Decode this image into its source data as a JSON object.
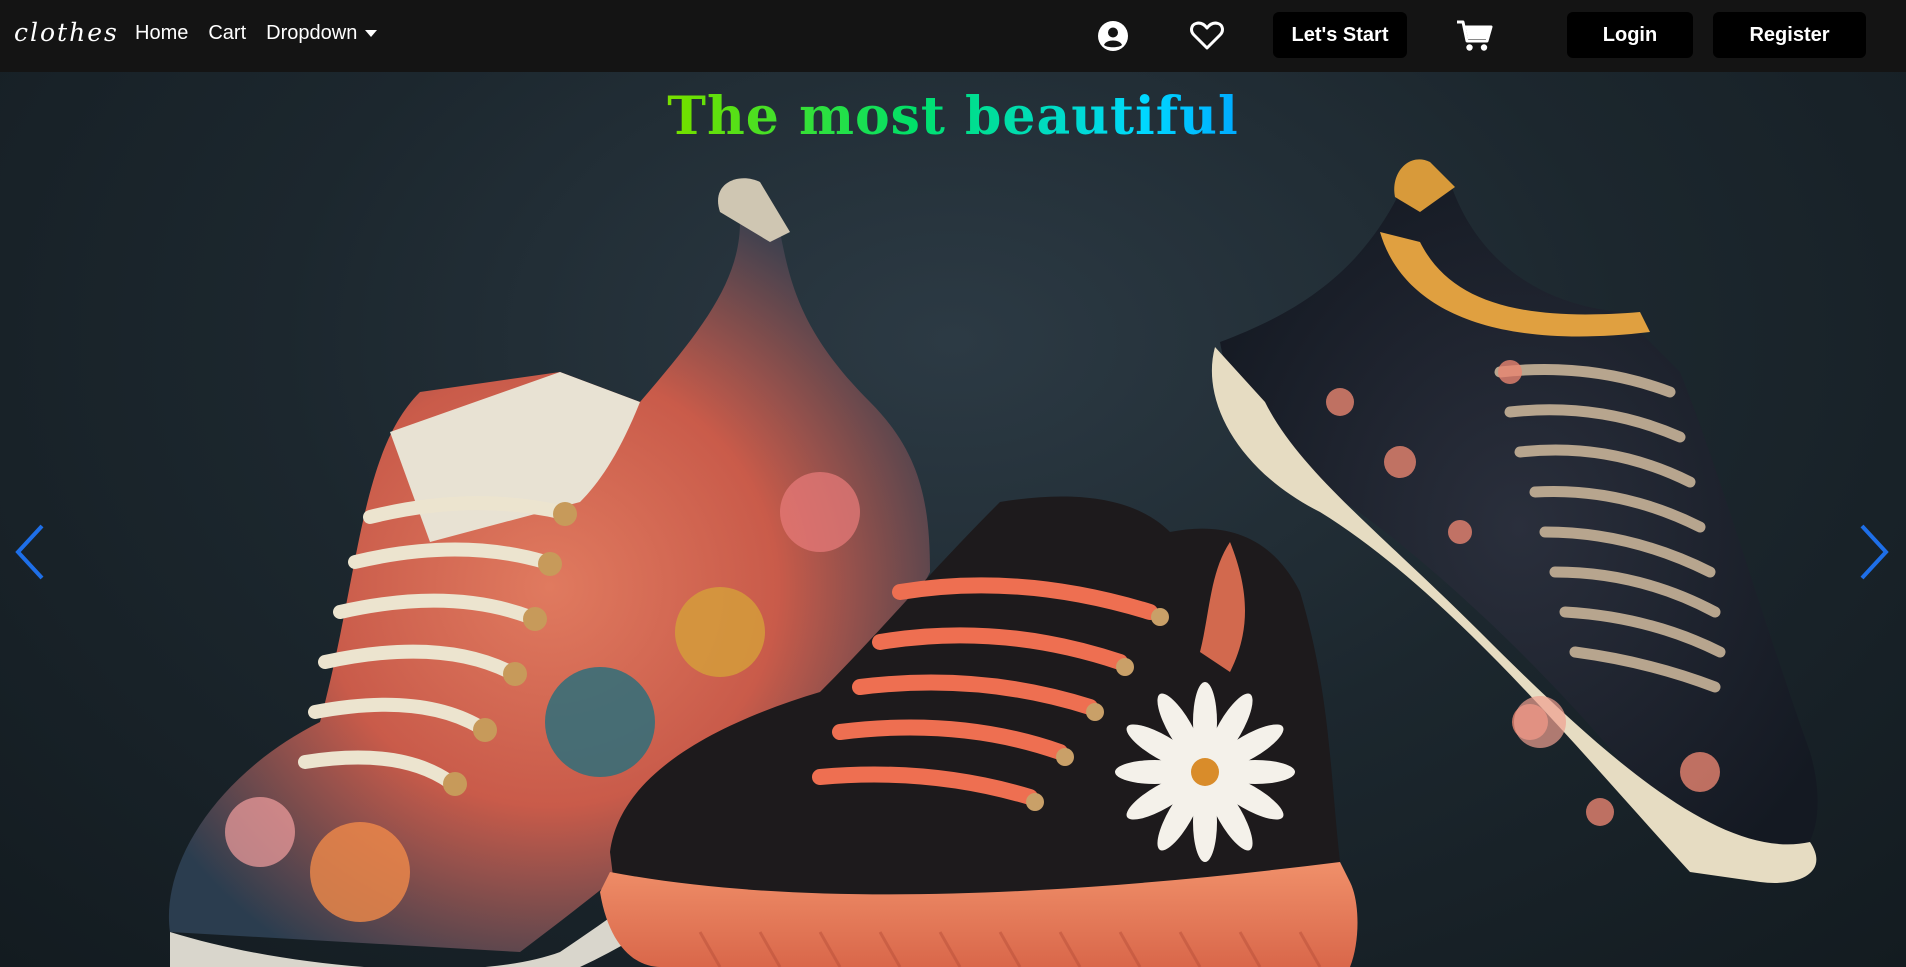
{
  "nav": {
    "brand": "clothes",
    "links": [
      "Home",
      "Cart",
      "Dropdown"
    ],
    "lets_start": "Let's Start",
    "login": "Login",
    "register": "Register"
  },
  "hero": {
    "headline": "The most beautiful"
  },
  "icons": {
    "account": "user-circle-icon",
    "wishlist": "heart-icon",
    "cart": "cart-icon",
    "prev": "chevron-left-icon",
    "next": "chevron-right-icon"
  },
  "colors": {
    "navbar": "#141414",
    "button": "#000000",
    "arrow": "#1e6fe8"
  }
}
